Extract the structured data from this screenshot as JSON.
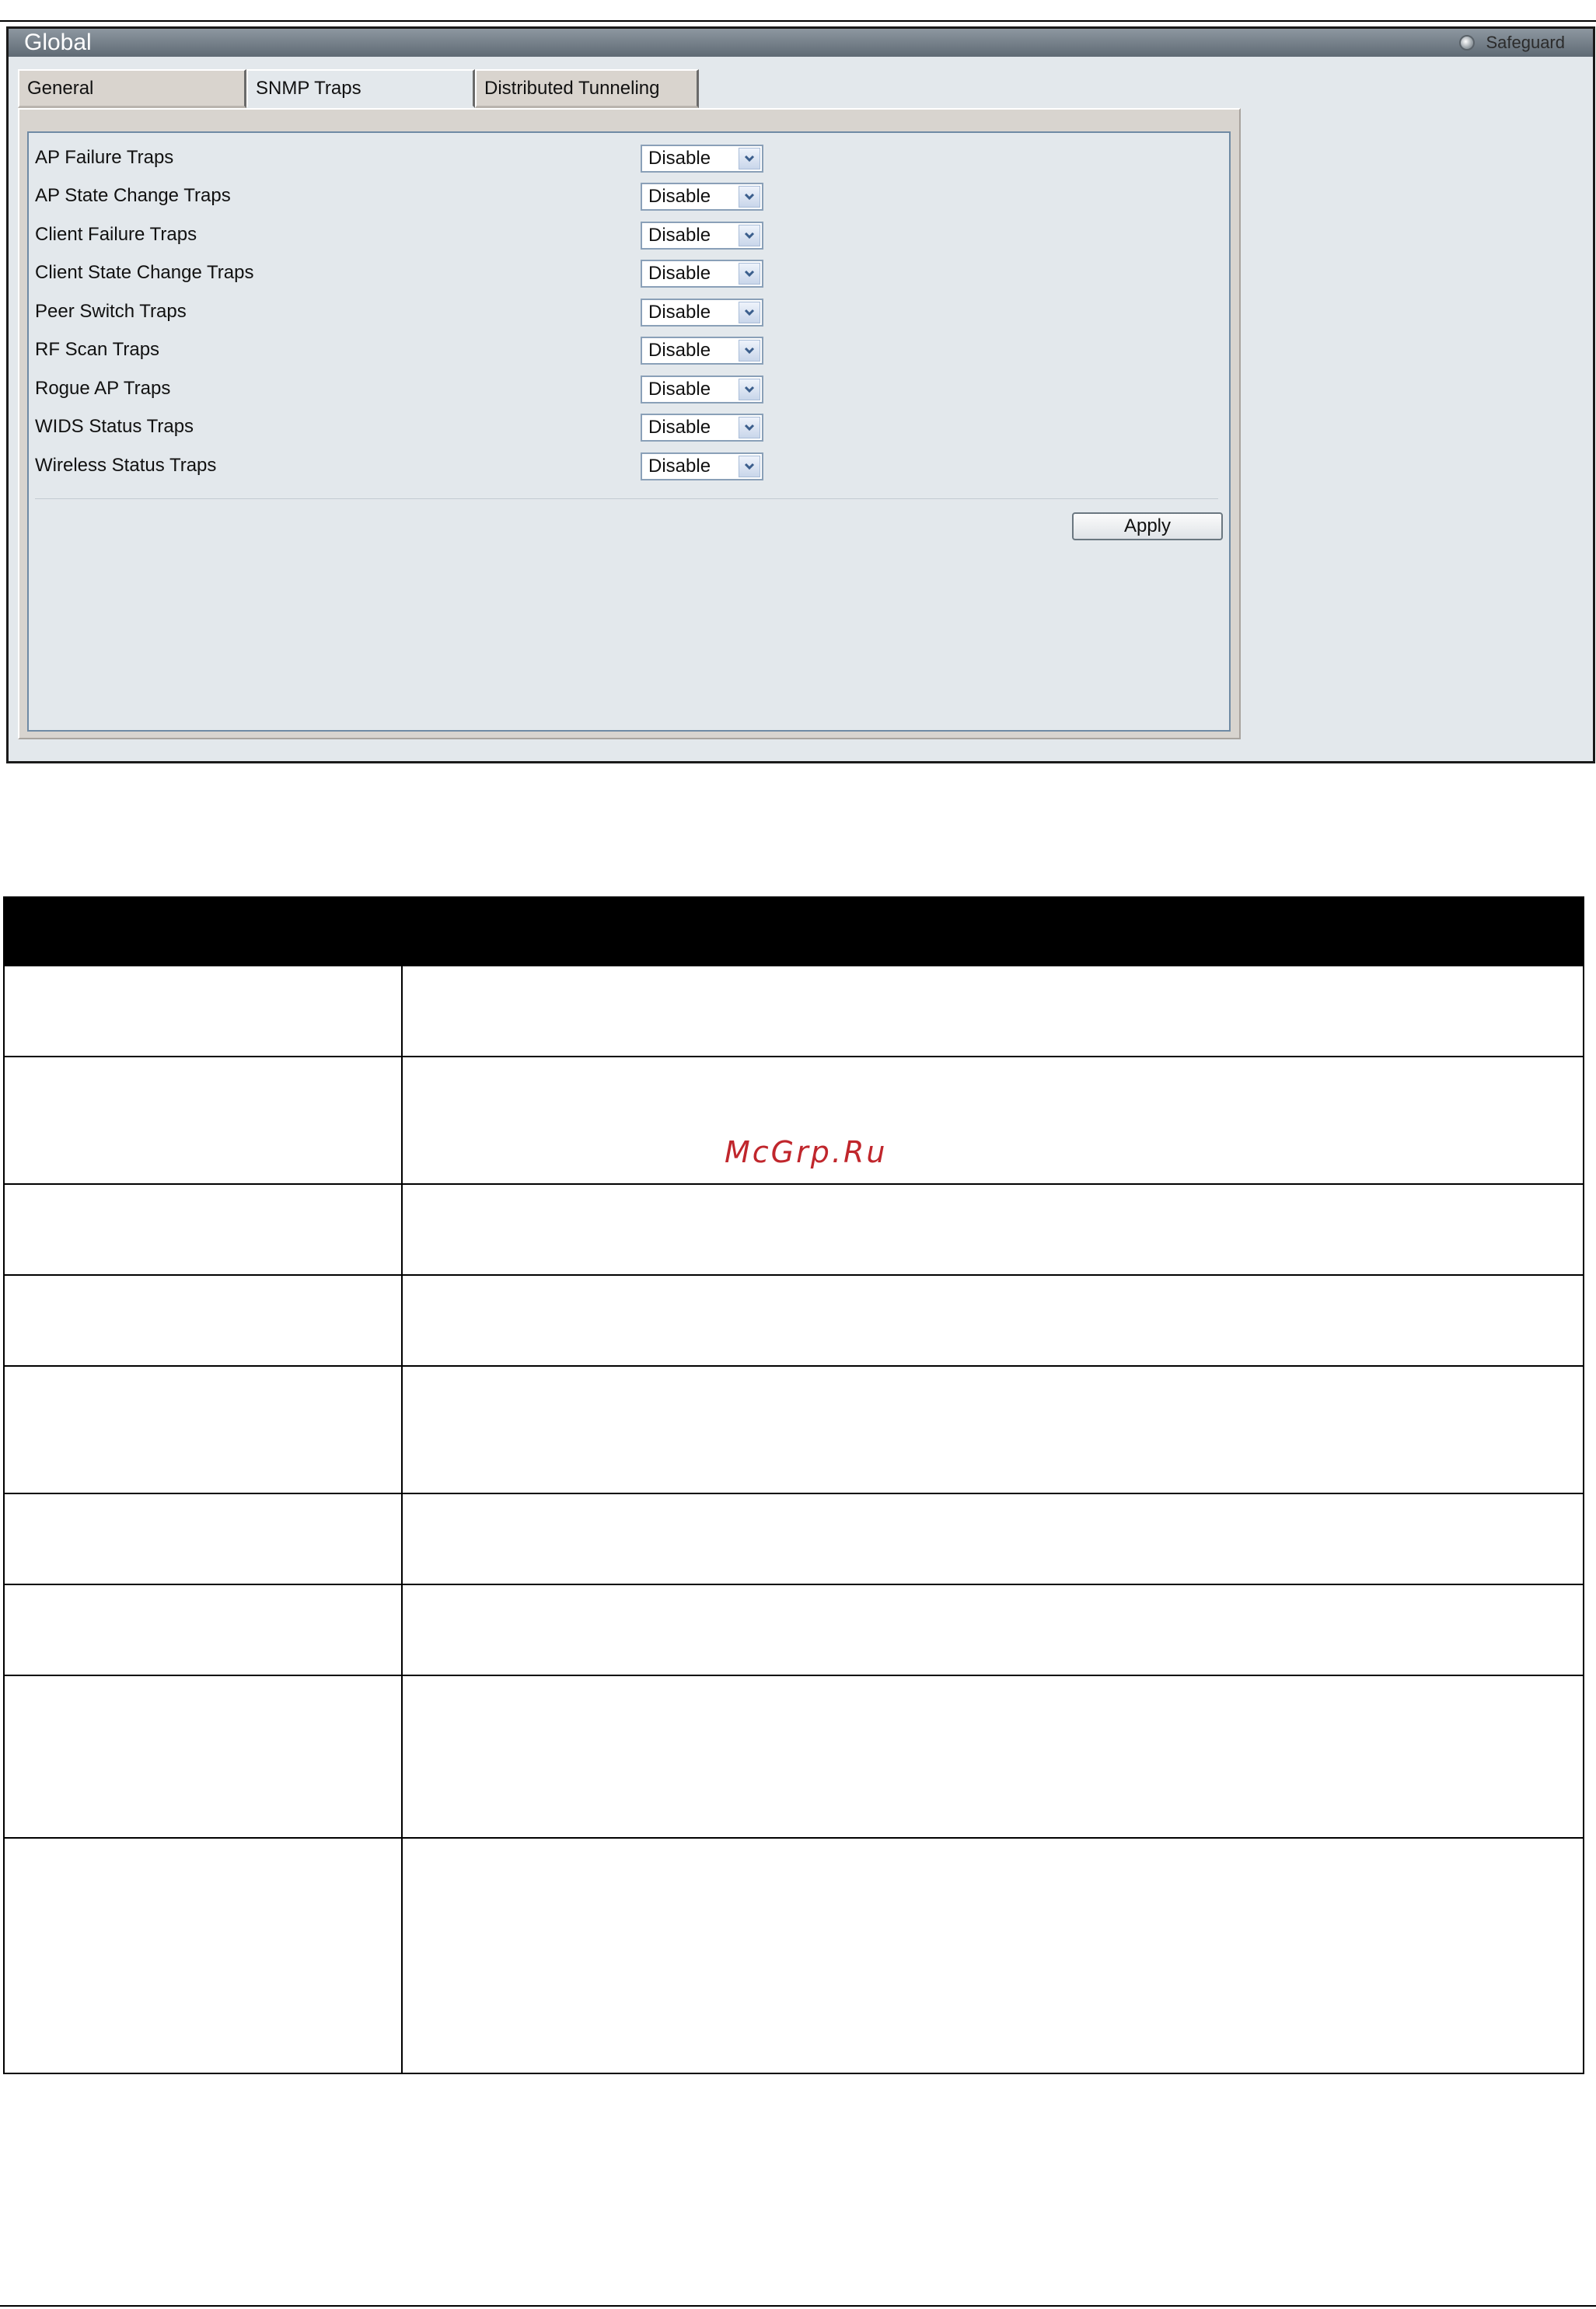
{
  "window": {
    "title": "Global",
    "brand": "Safeguard"
  },
  "tabs": [
    {
      "label": "General",
      "active": false
    },
    {
      "label": "SNMP Traps",
      "active": true
    },
    {
      "label": "Distributed Tunneling",
      "active": false
    }
  ],
  "traps": [
    {
      "label": "AP Failure Traps",
      "value": "Disable"
    },
    {
      "label": "AP State Change Traps",
      "value": "Disable"
    },
    {
      "label": "Client Failure Traps",
      "value": "Disable"
    },
    {
      "label": "Client State Change Traps",
      "value": "Disable"
    },
    {
      "label": "Peer Switch Traps",
      "value": "Disable"
    },
    {
      "label": "RF Scan Traps",
      "value": "Disable"
    },
    {
      "label": "Rogue AP Traps",
      "value": "Disable"
    },
    {
      "label": "WIDS Status Traps",
      "value": "Disable"
    },
    {
      "label": "Wireless Status Traps",
      "value": "Disable"
    }
  ],
  "apply_label": "Apply",
  "watermark": "McGrp.Ru",
  "colors": {
    "titlebar": "#6f7a84",
    "panel": "#d8d4cf",
    "content": "#e3e8ec",
    "inner_border": "#6f8aa4",
    "watermark": "#c0262c"
  }
}
